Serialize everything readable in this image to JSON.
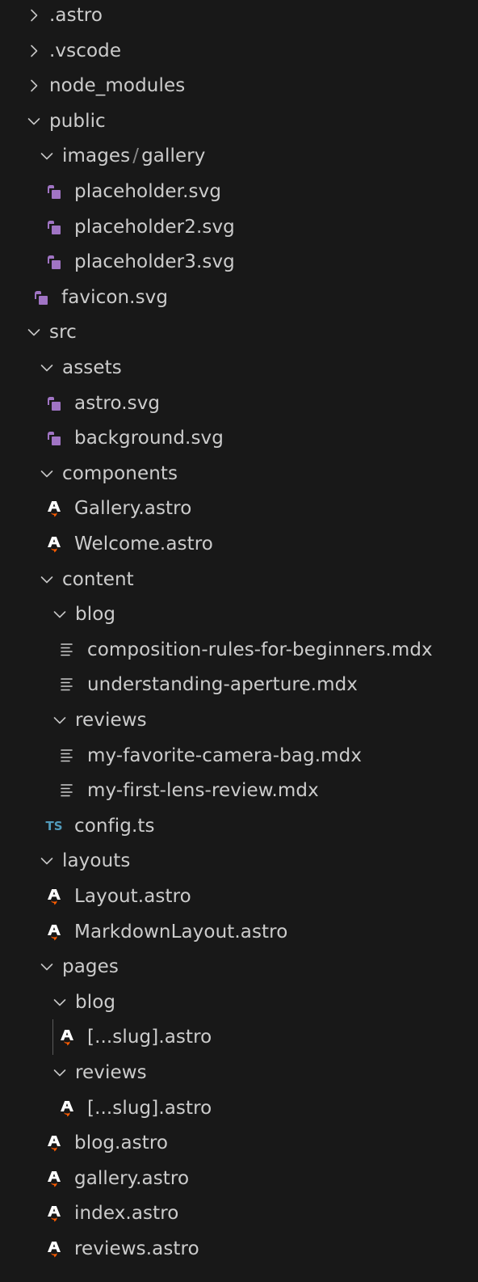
{
  "explorer": {
    "rows": [
      {
        "type": "folder",
        "expanded": false,
        "depth": 0,
        "label": ".astro"
      },
      {
        "type": "folder",
        "expanded": false,
        "depth": 0,
        "label": ".vscode"
      },
      {
        "type": "folder",
        "expanded": false,
        "depth": 0,
        "label": "node_modules"
      },
      {
        "type": "folder",
        "expanded": true,
        "depth": 0,
        "label": "public"
      },
      {
        "type": "folder",
        "expanded": true,
        "depth": 1,
        "label": "images",
        "label2": "gallery",
        "compact": true
      },
      {
        "type": "file",
        "icon": "svg-file-icon",
        "depth": 2,
        "label": "placeholder.svg"
      },
      {
        "type": "file",
        "icon": "svg-file-icon",
        "depth": 2,
        "label": "placeholder2.svg"
      },
      {
        "type": "file",
        "icon": "svg-file-icon",
        "depth": 2,
        "label": "placeholder3.svg"
      },
      {
        "type": "file",
        "icon": "svg-file-icon",
        "depth": 1,
        "label": "favicon.svg"
      },
      {
        "type": "folder",
        "expanded": true,
        "depth": 0,
        "label": "src"
      },
      {
        "type": "folder",
        "expanded": true,
        "depth": 1,
        "label": "assets"
      },
      {
        "type": "file",
        "icon": "svg-file-icon",
        "depth": 2,
        "label": "astro.svg"
      },
      {
        "type": "file",
        "icon": "svg-file-icon",
        "depth": 2,
        "label": "background.svg"
      },
      {
        "type": "folder",
        "expanded": true,
        "depth": 1,
        "label": "components"
      },
      {
        "type": "file",
        "icon": "astro-file-icon",
        "depth": 2,
        "label": "Gallery.astro"
      },
      {
        "type": "file",
        "icon": "astro-file-icon",
        "depth": 2,
        "label": "Welcome.astro"
      },
      {
        "type": "folder",
        "expanded": true,
        "depth": 1,
        "label": "content"
      },
      {
        "type": "folder",
        "expanded": true,
        "depth": 2,
        "label": "blog"
      },
      {
        "type": "file",
        "icon": "mdx-file-icon",
        "depth": 3,
        "label": "composition-rules-for-beginners.mdx"
      },
      {
        "type": "file",
        "icon": "mdx-file-icon",
        "depth": 3,
        "label": "understanding-aperture.mdx"
      },
      {
        "type": "folder",
        "expanded": true,
        "depth": 2,
        "label": "reviews"
      },
      {
        "type": "file",
        "icon": "mdx-file-icon",
        "depth": 3,
        "label": "my-favorite-camera-bag.mdx"
      },
      {
        "type": "file",
        "icon": "mdx-file-icon",
        "depth": 3,
        "label": "my-first-lens-review.mdx"
      },
      {
        "type": "file",
        "icon": "ts-file-icon",
        "iconText": "TS",
        "depth": 2,
        "label": "config.ts"
      },
      {
        "type": "folder",
        "expanded": true,
        "depth": 1,
        "label": "layouts"
      },
      {
        "type": "file",
        "icon": "astro-file-icon",
        "depth": 2,
        "label": "Layout.astro"
      },
      {
        "type": "file",
        "icon": "astro-file-icon",
        "depth": 2,
        "label": "MarkdownLayout.astro"
      },
      {
        "type": "folder",
        "expanded": true,
        "depth": 1,
        "label": "pages"
      },
      {
        "type": "folder",
        "expanded": true,
        "depth": 2,
        "label": "blog"
      },
      {
        "type": "file",
        "icon": "astro-file-icon",
        "depth": 3,
        "label": "[...slug].astro",
        "guide": true
      },
      {
        "type": "folder",
        "expanded": true,
        "depth": 2,
        "label": "reviews"
      },
      {
        "type": "file",
        "icon": "astro-file-icon",
        "depth": 3,
        "label": "[...slug].astro"
      },
      {
        "type": "file",
        "icon": "astro-file-icon",
        "depth": 2,
        "label": "blog.astro"
      },
      {
        "type": "file",
        "icon": "astro-file-icon",
        "depth": 2,
        "label": "gallery.astro"
      },
      {
        "type": "file",
        "icon": "astro-file-icon",
        "depth": 2,
        "label": "index.astro"
      },
      {
        "type": "file",
        "icon": "astro-file-icon",
        "depth": 2,
        "label": "reviews.astro"
      }
    ],
    "colors": {
      "background": "#181818",
      "text": "#cccccc",
      "chevron": "#c5c5c5",
      "svg_icon": "#a074c4",
      "ts_icon": "#519aba",
      "astro_icon_white": "#ffffff",
      "astro_icon_pink": "#ff5d01"
    }
  }
}
